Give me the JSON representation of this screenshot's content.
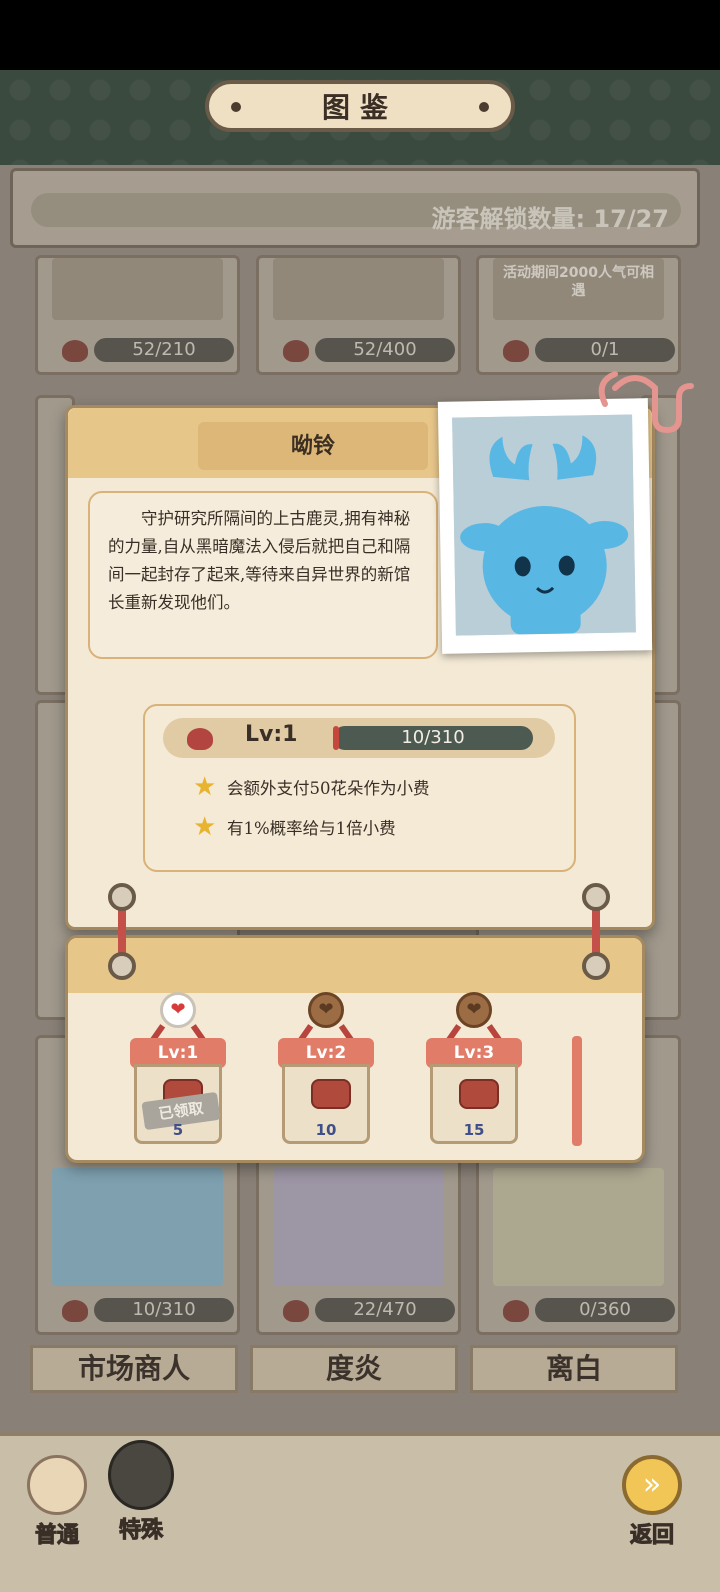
{
  "header": {
    "title": "图鉴"
  },
  "unlock": {
    "text": "游客解锁数量:  17/27"
  },
  "grid": {
    "row1": [
      {
        "progress": "52/210"
      },
      {
        "progress": "52/400"
      },
      {
        "event_text": "活动期间2000人气可相遇",
        "progress": "0/1"
      }
    ],
    "row_bottom": [
      {
        "progress": "10/310"
      },
      {
        "progress": "22/470"
      },
      {
        "progress": "0/360"
      }
    ],
    "names": [
      "市场商人",
      "度炎",
      "离白"
    ]
  },
  "detail": {
    "name": "呦铃",
    "description": "守护研究所隔间的上古鹿灵,拥有神秘的力量,自从黑暗魔法入侵后就把自己和隔间一起封存了起来,等待来自异世界的新馆长重新发现他们。",
    "level": "Lv:1",
    "progress": "10/310",
    "progress_fraction": 0.032,
    "perks": [
      "会额外支付50花朵作为小费",
      "有1%概率给与1倍小费"
    ]
  },
  "rewards": [
    {
      "level": "Lv:1",
      "amount": "5",
      "claimed_label": "已领取",
      "claimed": true
    },
    {
      "level": "Lv:2",
      "amount": "10",
      "claimed": false
    },
    {
      "level": "Lv:3",
      "amount": "15",
      "claimed": false
    }
  ],
  "bottom_nav": [
    {
      "label": "普通",
      "icon": "normal-visitor-icon"
    },
    {
      "label": "特殊",
      "icon": "special-visitor-icon"
    },
    {
      "label": "返回",
      "icon": "return-icon"
    }
  ],
  "colors": {
    "accent": "#e17c68",
    "heart": "#b34540",
    "panel": "#f3e9d5"
  }
}
